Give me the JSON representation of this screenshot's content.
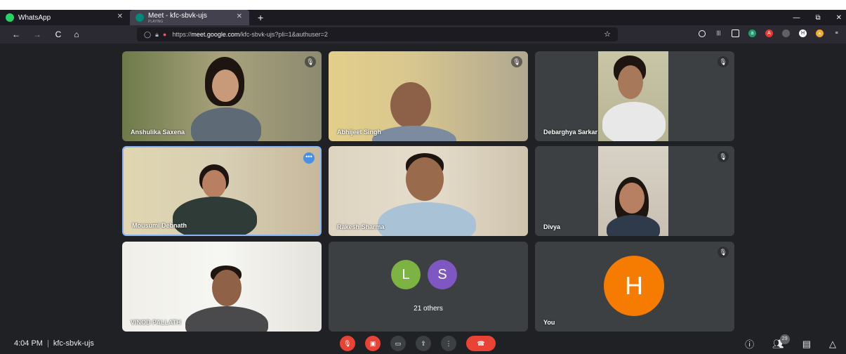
{
  "browser": {
    "tabs": [
      {
        "title": "WhatsApp",
        "icon": "whatsapp-icon"
      },
      {
        "title": "Meet - kfc-sbvk-ujs",
        "subtitle": "PLAYING",
        "icon": "meet-icon"
      }
    ],
    "new_tab": "+",
    "window_controls": {
      "minimize": "—",
      "restore": "⧉",
      "close": "✕"
    },
    "nav": {
      "back": "←",
      "forward": "→",
      "reload": "C",
      "home": "⌂"
    },
    "url_prefix": "https://",
    "url_domain": "meet.google.com",
    "url_path": "/kfc-sbvk-ujs?pli=1&authuser=2",
    "star": "☆"
  },
  "tiles": [
    {
      "name": "Anshulika Saxena",
      "muted": true
    },
    {
      "name": "Abhijeet Singh",
      "muted": true
    },
    {
      "name": "Debarghya Sarkar",
      "muted": true
    },
    {
      "name": "Mousumi Debnath",
      "muted": false
    },
    {
      "name": "Rakesh Sharma",
      "muted": false
    },
    {
      "name": "Divya",
      "muted": true
    },
    {
      "name": "VINOD PALLATH",
      "muted": false
    },
    {
      "name": "21 others",
      "avatars": [
        "L",
        "S"
      ],
      "muted": false
    },
    {
      "name": "You",
      "avatar": "H",
      "muted": true
    }
  ],
  "colors": {
    "avatar_l": "#7cb342",
    "avatar_s": "#7e57c2",
    "avatar_h": "#f57c00",
    "end_call": "#ea4335",
    "active_border": "#8ab4f8"
  },
  "meeting": {
    "time": "4:04 PM",
    "separator": "|",
    "code": "kfc-sbvk-ujs"
  },
  "controls": [
    "mic-off",
    "camera-off",
    "captions",
    "present",
    "more",
    "end-call"
  ],
  "right_controls": {
    "info_icon": "info-icon",
    "people_count": "29",
    "chat_icon": "chat-icon",
    "activities_icon": "activities-icon"
  }
}
